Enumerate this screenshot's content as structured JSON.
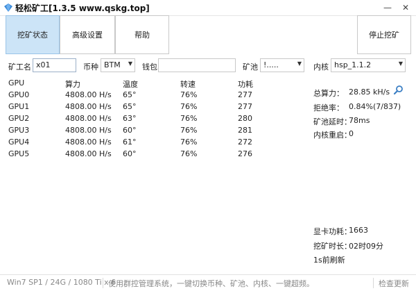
{
  "window": {
    "title": "轻松矿工[1.3.5 www.qskg.top]",
    "minimize_glyph": "—",
    "close_glyph": "✕",
    "icon": "diamond-icon"
  },
  "toolbar": {
    "mining_status": "挖矿状态",
    "advanced_settings": "高级设置",
    "help": "帮助",
    "stop_mining": "停止挖矿"
  },
  "form": {
    "worker_label": "矿工名",
    "worker_value": "x01",
    "coin_label": "币种",
    "coin_value": "BTM",
    "wallet_label": "钱包",
    "wallet_value": "",
    "pool_label": "矿池",
    "pool_value": "!.....",
    "kernel_label": "内核",
    "kernel_value": "hsp_1.1.2"
  },
  "table": {
    "headers": {
      "gpu": "GPU",
      "hashrate": "算力",
      "temp": "温度",
      "fan": "转速",
      "power": "功耗"
    },
    "rows": [
      {
        "gpu": "GPU0",
        "hashrate": "4808.00 H/s",
        "temp": "65°",
        "fan": "76%",
        "power": "277"
      },
      {
        "gpu": "GPU1",
        "hashrate": "4808.00 H/s",
        "temp": "65°",
        "fan": "76%",
        "power": "277"
      },
      {
        "gpu": "GPU2",
        "hashrate": "4808.00 H/s",
        "temp": "63°",
        "fan": "76%",
        "power": "280"
      },
      {
        "gpu": "GPU3",
        "hashrate": "4808.00 H/s",
        "temp": "60°",
        "fan": "76%",
        "power": "281"
      },
      {
        "gpu": "GPU4",
        "hashrate": "4808.00 H/s",
        "temp": "61°",
        "fan": "76%",
        "power": "272"
      },
      {
        "gpu": "GPU5",
        "hashrate": "4808.00 H/s",
        "temp": "60°",
        "fan": "76%",
        "power": "276"
      }
    ]
  },
  "stats": {
    "total_hash_label": "总算力：",
    "total_hash_value": "28.85 kH/s",
    "reject_label": "拒绝率：",
    "reject_value": "0.84%(7/837)",
    "latency_label": "矿池延时：",
    "latency_value": "78ms",
    "restart_label": "内核重启：",
    "restart_value": "0",
    "card_power_label": "显卡功耗：",
    "card_power_value": "1663",
    "mining_time_label": "挖矿时长：",
    "mining_time_value": "02时09分",
    "refresh_note": "1s前刷新",
    "search_icon": "magnifier-icon"
  },
  "statusbar": {
    "system": "Win7 SP1 / 24G / 1080 Ti x 6",
    "ad": "使用群控管理系统，一键切换币种、矿池、内核、一键超频。",
    "check_update": "检查更新"
  },
  "colors": {
    "active_tab": "#cce4f7",
    "input_border": "#9bb0c8",
    "search_icon": "#3b7fc4"
  }
}
